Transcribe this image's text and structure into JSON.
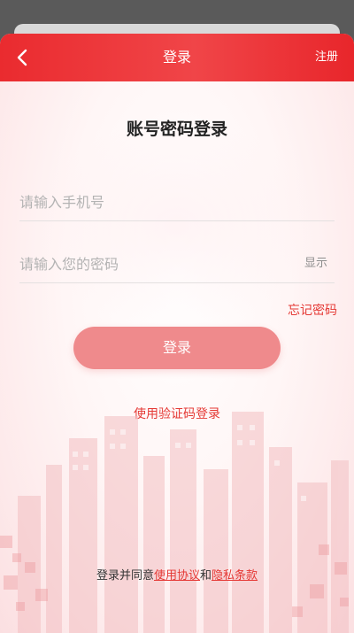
{
  "header": {
    "title": "登录",
    "register_label": "注册",
    "back_icon": "chevron-left-icon"
  },
  "page_title": "账号密码登录",
  "form": {
    "phone_placeholder": "请输入手机号",
    "password_placeholder": "请输入您的密码",
    "show_label": "显示",
    "forgot_label": "忘记密码",
    "login_label": "登录",
    "sms_login_label": "使用验证码登录"
  },
  "agreement": {
    "prefix": "登录并同意",
    "terms_label": "使用协议",
    "conjunction": "和",
    "privacy_label": "隐私条款"
  },
  "colors": {
    "accent": "#e53935",
    "header": "#ea2b2f",
    "button_disabled": "#ef8a8c"
  }
}
